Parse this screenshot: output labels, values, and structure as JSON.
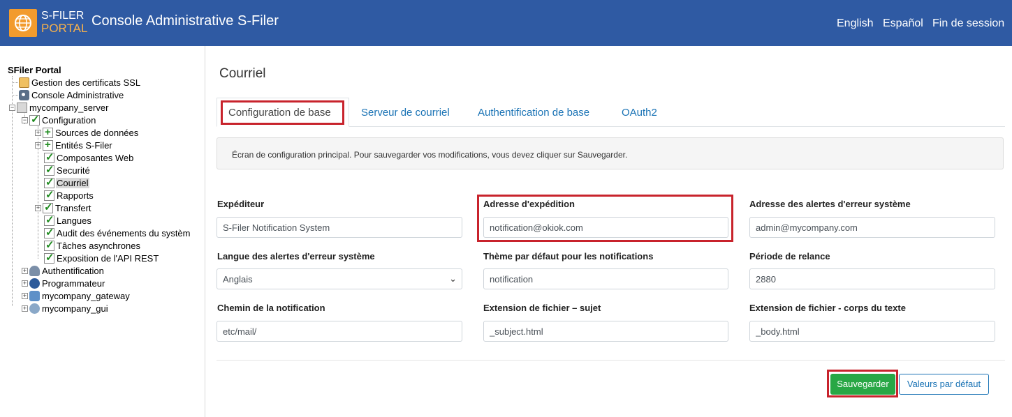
{
  "header": {
    "logo_line1": "S-FILER",
    "logo_line2": "PORTAL",
    "title": "Console Administrative S-Filer",
    "links": [
      "English",
      "Español",
      "Fin de session"
    ]
  },
  "sidebar": {
    "root": "SFiler Portal",
    "items": [
      {
        "label": "Gestion des certificats SSL",
        "icon": "certificate-icon"
      },
      {
        "label": "Console Administrative",
        "icon": "gear-icon"
      },
      {
        "label": "mycompany_server",
        "icon": "server-icon"
      },
      {
        "label": "Configuration",
        "icon": "checklist-icon"
      },
      {
        "label": "Sources de données",
        "icon": "add-icon"
      },
      {
        "label": "Entités S-Filer",
        "icon": "add-icon"
      },
      {
        "label": "Composantes Web",
        "icon": "checklist-icon"
      },
      {
        "label": "Securité",
        "icon": "checklist-icon"
      },
      {
        "label": "Courriel",
        "icon": "checklist-icon"
      },
      {
        "label": "Rapports",
        "icon": "checklist-icon"
      },
      {
        "label": "Transfert",
        "icon": "checklist-icon"
      },
      {
        "label": "Langues",
        "icon": "checklist-icon"
      },
      {
        "label": "Audit des événements du systèm",
        "icon": "checklist-icon"
      },
      {
        "label": "Tâches asynchrones",
        "icon": "checklist-icon"
      },
      {
        "label": "Exposition de l'API REST",
        "icon": "checklist-icon"
      },
      {
        "label": "Authentification",
        "icon": "users-icon"
      },
      {
        "label": "Programmateur",
        "icon": "clock-icon"
      },
      {
        "label": "mycompany_gateway",
        "icon": "network-icon"
      },
      {
        "label": "mycompany_gui",
        "icon": "globe-icon"
      }
    ]
  },
  "main": {
    "title": "Courriel",
    "tabs": [
      "Configuration de base",
      "Serveur de courriel",
      "Authentification de base",
      "OAuth2"
    ],
    "info": "Écran de configuration principal. Pour sauvegarder vos modifications, vous devez cliquer sur Sauvegarder.",
    "fields": {
      "expediteur": {
        "label": "Expéditeur",
        "value": "S-Filer Notification System"
      },
      "adresse": {
        "label": "Adresse d'expédition",
        "value": "notification@okiok.com"
      },
      "alertes": {
        "label": "Adresse des alertes d'erreur système",
        "value": "admin@mycompany.com"
      },
      "langue": {
        "label": "Langue des alertes d'erreur système",
        "value": "Anglais"
      },
      "theme": {
        "label": "Thème par défaut pour les notifications",
        "value": "notification"
      },
      "periode": {
        "label": "Période de relance",
        "value": "2880"
      },
      "chemin": {
        "label": "Chemin de la notification",
        "value": "etc/mail/"
      },
      "ext_sujet": {
        "label": "Extension de fichier – sujet",
        "value": "_subject.html"
      },
      "ext_corps": {
        "label": "Extension de fichier - corps du texte",
        "value": "_body.html"
      }
    },
    "buttons": {
      "save": "Sauvegarder",
      "defaults": "Valeurs par défaut"
    },
    "colors": {
      "header": "#2f5aa3",
      "highlight": "#c8232c",
      "save": "#28a745",
      "link": "#1a73b5"
    }
  }
}
